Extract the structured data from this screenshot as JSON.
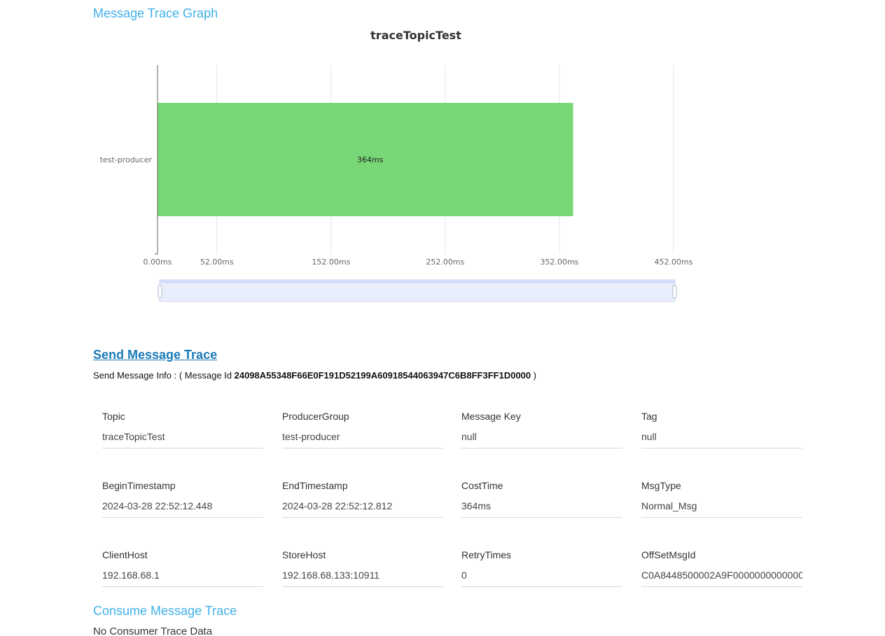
{
  "graph_section": {
    "title": "Message Trace Graph"
  },
  "chart_data": {
    "type": "bar",
    "orientation": "horizontal",
    "title": "traceTopicTest",
    "categories": [
      "test-producer"
    ],
    "values": [
      364
    ],
    "data_labels": [
      "364ms"
    ],
    "x_ticks": [
      "0.00ms",
      "52.00ms",
      "152.00ms",
      "252.00ms",
      "352.00ms",
      "452.00ms"
    ],
    "x_tick_values": [
      0,
      52,
      152,
      252,
      352,
      452
    ],
    "xlim": [
      0,
      452
    ],
    "unit": "ms",
    "grid": true,
    "bar_color": "#78d878",
    "has_zoom_slider": true
  },
  "send_section": {
    "title": "Send Message Trace",
    "info_prefix": "Send Message Info : ( Message Id ",
    "message_id": "24098A55348F66E0F191D52199A60918544063947C6B8FF3FF1D0000",
    "info_suffix": " )"
  },
  "fields": [
    {
      "label": "Topic",
      "value": "traceTopicTest"
    },
    {
      "label": "ProducerGroup",
      "value": "test-producer"
    },
    {
      "label": "Message Key",
      "value": "null"
    },
    {
      "label": "Tag",
      "value": "null"
    },
    {
      "label": "BeginTimestamp",
      "value": "2024-03-28 22:52:12.448"
    },
    {
      "label": "EndTimestamp",
      "value": "2024-03-28 22:52:12.812"
    },
    {
      "label": "CostTime",
      "value": "364ms"
    },
    {
      "label": "MsgType",
      "value": "Normal_Msg"
    },
    {
      "label": "ClientHost",
      "value": "192.168.68.1"
    },
    {
      "label": "StoreHost",
      "value": "192.168.68.133:10911"
    },
    {
      "label": "RetryTimes",
      "value": "0"
    },
    {
      "label": "OffSetMsgId",
      "value": "C0A8448500002A9F0000000000000"
    }
  ],
  "consume_section": {
    "title": "Consume Message Trace",
    "empty_text": "No Consumer Trace Data"
  }
}
